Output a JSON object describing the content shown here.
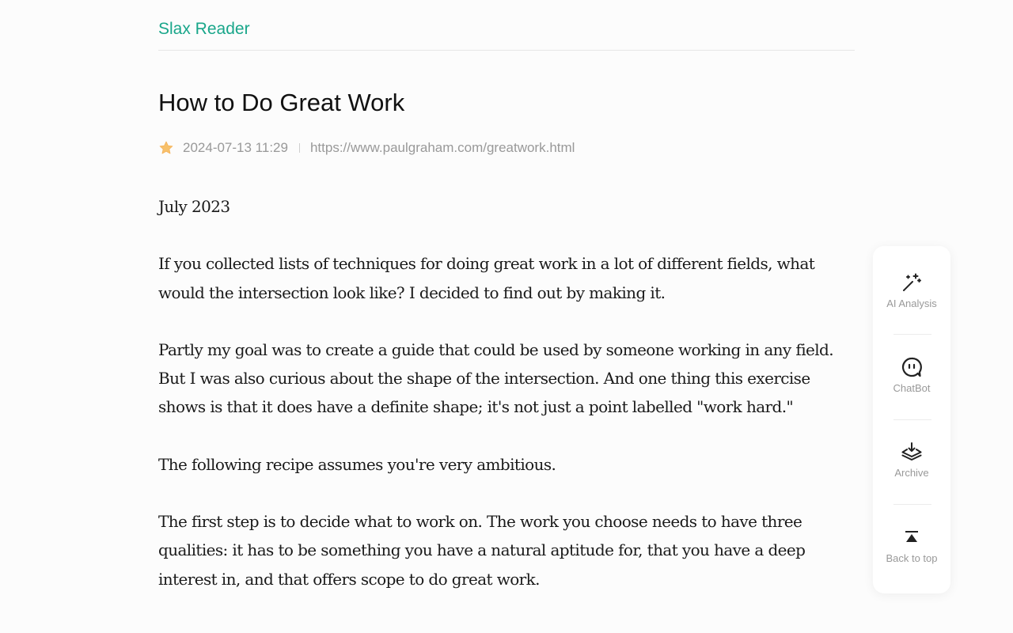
{
  "header": {
    "brand": "Slax Reader"
  },
  "article": {
    "title": "How to Do Great Work",
    "meta": {
      "date": "2024-07-13 11:29",
      "url": "https://www.paulgraham.com/greatwork.html"
    },
    "paragraphs": [
      "July 2023",
      "If you collected lists of techniques for doing great work in a lot of different fields, what would the intersection look like? I decided to find out by making it.",
      "Partly my goal was to create a guide that could be used by someone working in any field. But I was also curious about the shape of the intersection. And one thing this exercise shows is that it does have a definite shape; it's not just a point labelled \"work hard.\"",
      "The following recipe assumes you're very ambitious.",
      "The first step is to decide what to work on. The work you choose needs to have three qualities: it has to be something you have a natural aptitude for, that you have a deep interest in, and that offers scope to do great work."
    ]
  },
  "sidebar": {
    "tools": [
      {
        "label": "AI Analysis",
        "icon": "magic-wand-icon"
      },
      {
        "label": "ChatBot",
        "icon": "chatbot-icon"
      },
      {
        "label": "Archive",
        "icon": "archive-icon"
      },
      {
        "label": "Back to top",
        "icon": "back-to-top-icon"
      }
    ]
  },
  "colors": {
    "brand": "#19a68a",
    "star": "#f7c16b",
    "text": "#1a1a1a",
    "muted": "#999999",
    "background": "#fcfcfc"
  }
}
